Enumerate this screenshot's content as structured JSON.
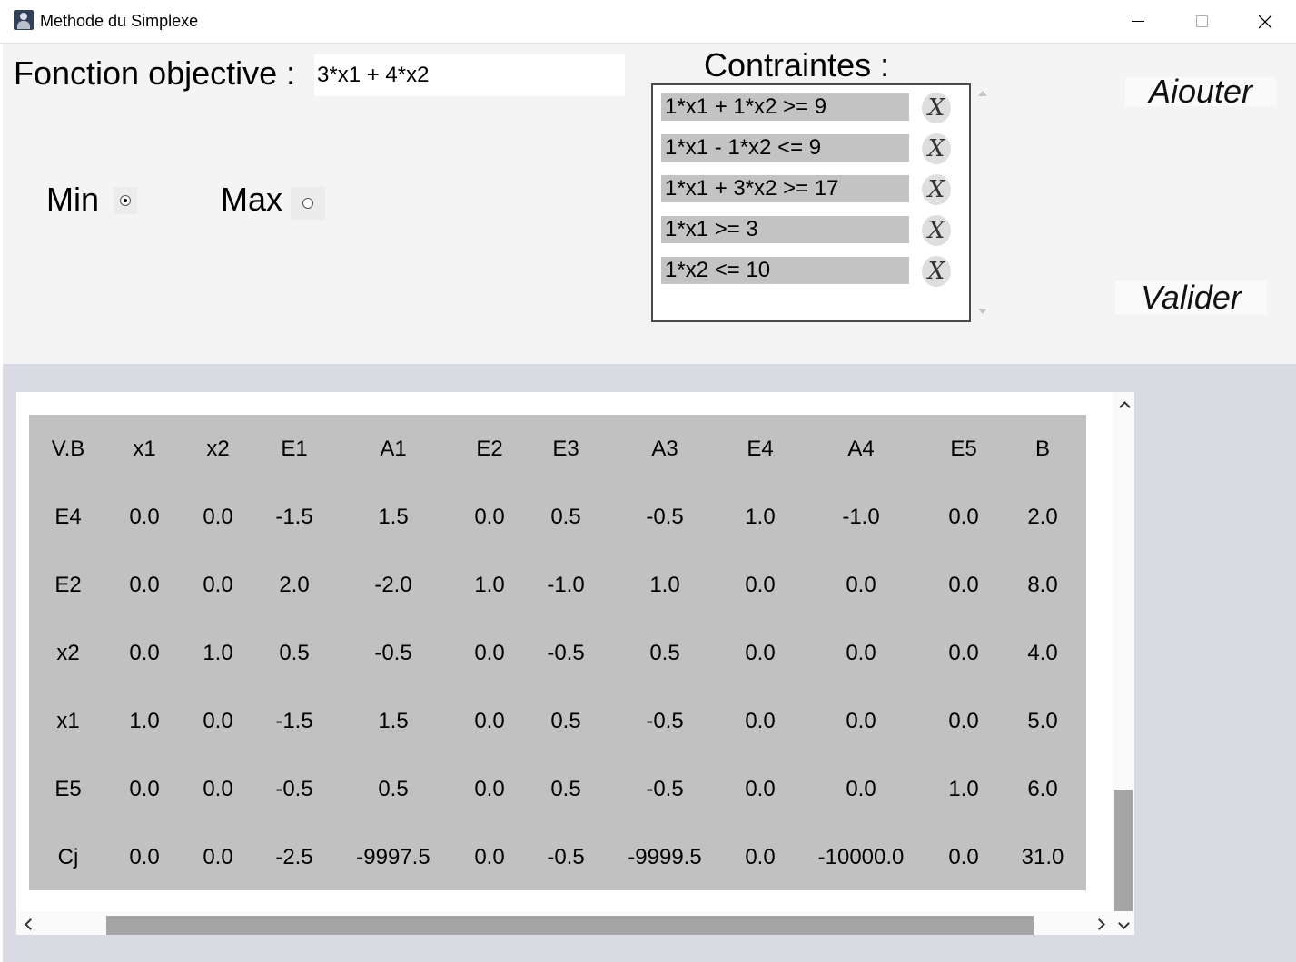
{
  "window": {
    "title": "Methode du Simplexe"
  },
  "objective": {
    "label": "Fonction objective :",
    "value": "3*x1 + 4*x2"
  },
  "mode": {
    "min_label": "Min",
    "max_label": "Max",
    "selected": "Min"
  },
  "constraints": {
    "title": "Contraintes :",
    "items": [
      "1*x1 + 1*x2 >= 9",
      "1*x1 - 1*x2 <= 9",
      "1*x1 + 3*x2 >= 17",
      "1*x1 >= 3",
      "1*x2 <= 10"
    ],
    "delete_glyph": "X"
  },
  "buttons": {
    "add": "Aiouter",
    "validate": "Valider"
  },
  "tableau": {
    "headers": [
      "V.B",
      "x1",
      "x2",
      "E1",
      "A1",
      "E2",
      "E3",
      "A3",
      "E4",
      "A4",
      "E5",
      "B"
    ],
    "rows": [
      [
        "E4",
        "0.0",
        "0.0",
        "-1.5",
        "1.5",
        "0.0",
        "0.5",
        "-0.5",
        "1.0",
        "-1.0",
        "0.0",
        "2.0"
      ],
      [
        "E2",
        "0.0",
        "0.0",
        "2.0",
        "-2.0",
        "1.0",
        "-1.0",
        "1.0",
        "0.0",
        "0.0",
        "0.0",
        "8.0"
      ],
      [
        "x2",
        "0.0",
        "1.0",
        "0.5",
        "-0.5",
        "0.0",
        "-0.5",
        "0.5",
        "0.0",
        "0.0",
        "0.0",
        "4.0"
      ],
      [
        "x1",
        "1.0",
        "0.0",
        "-1.5",
        "1.5",
        "0.0",
        "0.5",
        "-0.5",
        "0.0",
        "0.0",
        "0.0",
        "5.0"
      ],
      [
        "E5",
        "0.0",
        "0.0",
        "-0.5",
        "0.5",
        "0.0",
        "0.5",
        "-0.5",
        "0.0",
        "0.0",
        "1.0",
        "6.0"
      ],
      [
        "Cj",
        "0.0",
        "0.0",
        "-2.5",
        "-9997.5",
        "0.0",
        "-0.5",
        "-9999.5",
        "0.0",
        "-10000.0",
        "0.0",
        "31.0"
      ]
    ]
  }
}
